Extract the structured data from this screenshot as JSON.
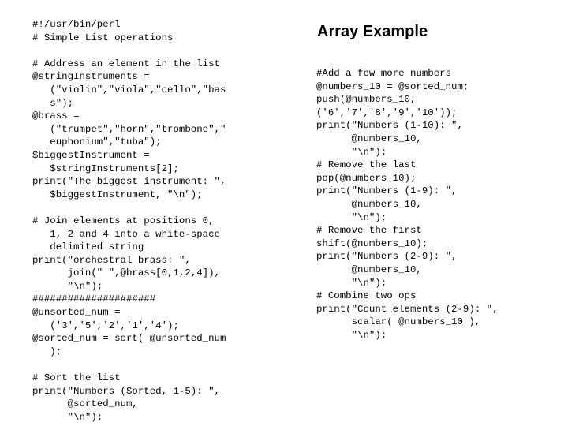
{
  "slide": {
    "title": "Array Example",
    "background_color": "#ffffff",
    "text_color": "#000000"
  },
  "left_column": {
    "language": "perl",
    "lines": [
      "#!/usr/bin/perl",
      "# Simple List operations",
      "",
      "# Address an element in the list",
      "@stringInstruments =",
      "   (\"violin\",\"viola\",\"cello\",\"bas",
      "   s\");",
      "@brass =",
      "   (\"trumpet\",\"horn\",\"trombone\",\"",
      "   euphonium\",\"tuba\");",
      "$biggestInstrument =",
      "   $stringInstruments[2];",
      "print(\"The biggest instrument: \",",
      "   $biggestInstrument, \"\\n\");",
      "",
      "# Join elements at positions 0,",
      "   1, 2 and 4 into a white-space",
      "   delimited string",
      "print(\"orchestral brass: \",",
      "      join(\" \",@brass[0,1,2,4]),",
      "      \"\\n\");",
      "#####################",
      "@unsorted_num =",
      "   ('3','5','2','1','4');",
      "@sorted_num = sort( @unsorted_num",
      "   );",
      "",
      "# Sort the list",
      "print(\"Numbers (Sorted, 1-5): \",",
      "      @sorted_num,",
      "      \"\\n\");"
    ]
  },
  "right_column": {
    "language": "perl",
    "lines": [
      "#Add a few more numbers",
      "@numbers_10 = @sorted_num;",
      "push(@numbers_10,",
      "('6','7','8','9','10'));",
      "print(\"Numbers (1-10): \",",
      "      @numbers_10,",
      "      \"\\n\");",
      "# Remove the last",
      "pop(@numbers_10);",
      "print(\"Numbers (1-9): \",",
      "      @numbers_10,",
      "      \"\\n\");",
      "# Remove the first",
      "shift(@numbers_10);",
      "print(\"Numbers (2-9): \",",
      "      @numbers_10,",
      "      \"\\n\");",
      "# Combine two ops",
      "print(\"Count elements (2-9): \",",
      "      scalar( @numbers_10 ),",
      "      \"\\n\");"
    ]
  }
}
